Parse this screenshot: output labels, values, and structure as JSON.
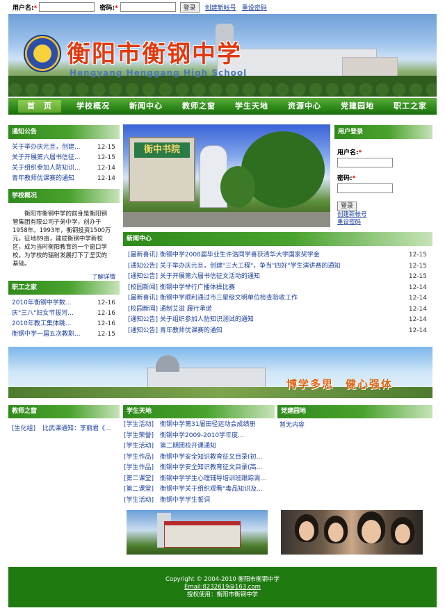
{
  "topbar": {
    "username_label": "用户名:",
    "password_label": "密码:",
    "required_mark": "*",
    "login_button": "登录",
    "register_link": "创建新帐号",
    "reset_link": "重设密码"
  },
  "banner": {
    "school_name": "衡阳市衡钢中学",
    "school_name_en": "Hengyang Henggang High School"
  },
  "nav": {
    "items": [
      "首　页",
      "学校概况",
      "新闻中心",
      "教师之窗",
      "学生天地",
      "资源中心",
      "党建园地",
      "职工之家"
    ]
  },
  "notice": {
    "title": "通知公告",
    "items": [
      {
        "text": "关于举办庆元旦，创建...",
        "date": "12-15"
      },
      {
        "text": "关于开展第六届书信征...",
        "date": "12-15"
      },
      {
        "text": "关于组织参加人防知识...",
        "date": "12-14"
      },
      {
        "text": "青年教师优课赛的通知",
        "date": "12-14"
      }
    ]
  },
  "about": {
    "title": "学校概况",
    "text": "衡阳市衡钢中学的前身是衡阳钢管集团有限公司子弟中学，创办于1958年。1993年，衡钢投资1500万元，征地89亩，建成衡钢中学新校区，成为当时衡阳教育的一个窗口学校，为学校的辐射发展打下了坚实的基础。",
    "more": "了解详情"
  },
  "staff": {
    "title": "职工之家",
    "items": [
      {
        "text": "2010年衡钢中学数...",
        "date": "12-16"
      },
      {
        "text": "庆\"三八\"妇女节拔河...",
        "date": "12-16"
      },
      {
        "text": "2010年教工集体跳...",
        "date": "12-16"
      },
      {
        "text": "衡钢中学一届五次教职...",
        "date": "12-15"
      }
    ]
  },
  "photo_main": {
    "sign": "衡中书院"
  },
  "login": {
    "title": "用户登录",
    "username_label": "用户名:",
    "password_label": "密码:",
    "required_mark": "*",
    "button": "登录",
    "register_link": "创建新帐号",
    "reset_link": "重设密码"
  },
  "news": {
    "title": "新闻中心",
    "items": [
      {
        "text": "[最新喜讯]  衡钢中学2008届毕业生许浩同学喜获清华大学国家奖学金",
        "date": "12-15"
      },
      {
        "text": "[通知公告]  关于举办庆元旦，创建\"三大工程\"，争当\"四好\"学生演讲赛的通知",
        "date": "12-15"
      },
      {
        "text": "[通知公告]  关于开展第六届书信征文活动的通知",
        "date": "12-15"
      },
      {
        "text": "[校园新闻]  衡钢中学举行广播体操比赛",
        "date": "12-14"
      },
      {
        "text": "[最新喜讯]  衡钢中学顺利通过市三星级文明单位检查验收工作",
        "date": "12-14"
      },
      {
        "text": "[校园新闻]  通制艾滋  履行承诺",
        "date": "12-14"
      },
      {
        "text": "[通知公告]  关于组织参加人防知识测试的通知",
        "date": "12-14"
      },
      {
        "text": "[通知公告]  青年教师优课赛的通知",
        "date": "12-14"
      }
    ]
  },
  "banner2": {
    "slogan": "博学多思　健心强体"
  },
  "teacher": {
    "title": "教师之窗",
    "items": [
      {
        "cat": "[生化组]",
        "text": "比武课通知：李丽君《..."
      }
    ]
  },
  "student": {
    "title": "学生天地",
    "items": [
      {
        "cat": "[学生活动]",
        "text": "衡钢中学第31届田径运动会成绩册"
      },
      {
        "cat": "[学生荣誉]",
        "text": "衡钢中学2009-2010学年度..."
      },
      {
        "cat": "[学生活动]",
        "text": "第二期团校开课通知"
      },
      {
        "cat": "[学生作品]",
        "text": "衡钢中学安全知识教育征文目录(初..."
      },
      {
        "cat": "[学生作品]",
        "text": "衡钢中学安全知识教育征文目录(高..."
      },
      {
        "cat": "[第二课堂]",
        "text": "衡钢中学学生心理辅导培训班跟踪调..."
      },
      {
        "cat": "[第二课堂]",
        "text": "衡钢中学关于组织观看\"毒品知识及..."
      },
      {
        "cat": "[学生活动]",
        "text": "衡钢中学学生誓词"
      }
    ]
  },
  "party": {
    "title": "党建园地",
    "empty": "暂无内容"
  },
  "footer": {
    "copyright": "Copyright © 2004-2010  衡阳市衡钢中学",
    "email": "Email:8232619@163.com",
    "license": "授权使用：衡阳市衡钢中学"
  }
}
